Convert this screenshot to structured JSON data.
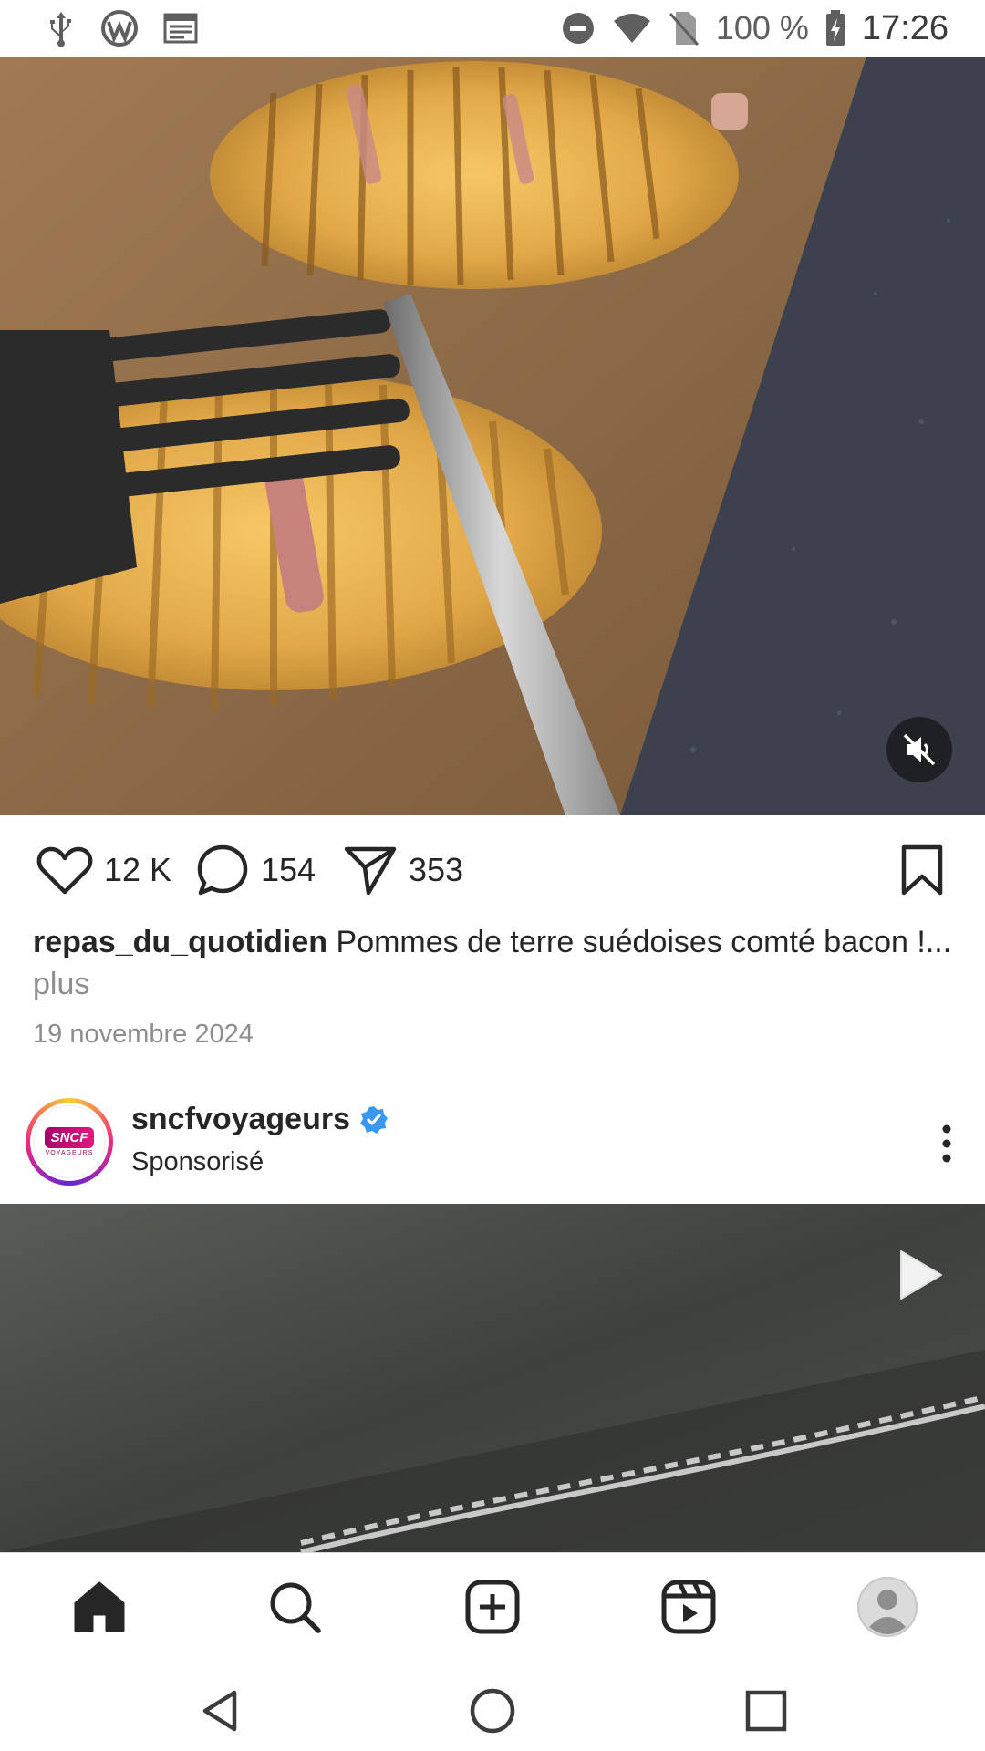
{
  "status_bar": {
    "battery": "100 %",
    "time": "17:26",
    "icons": [
      "usb-icon",
      "wordpress-icon",
      "news-icon",
      "do-not-disturb-icon",
      "wifi-icon",
      "no-sim-icon",
      "battery-charging-icon"
    ]
  },
  "post1": {
    "likes": "12 K",
    "comments": "154",
    "shares": "353",
    "username": "repas_du_quotidien",
    "caption": "Pommes de terre suédoises comté bacon !...",
    "more_label": "plus",
    "date": "19 novembre 2024",
    "muted": true
  },
  "post2": {
    "username": "sncfvoyageurs",
    "verified": true,
    "sponsored_label": "Sponsorisé",
    "avatar_text": "SNCF",
    "avatar_subtext": "VOYAGEURS"
  },
  "bottom_nav": {
    "items": [
      "home",
      "search",
      "create",
      "reels",
      "profile"
    ]
  },
  "colors": {
    "verified_blue": "#3897f0",
    "text": "#262626",
    "muted_text": "#8e8e8e"
  }
}
